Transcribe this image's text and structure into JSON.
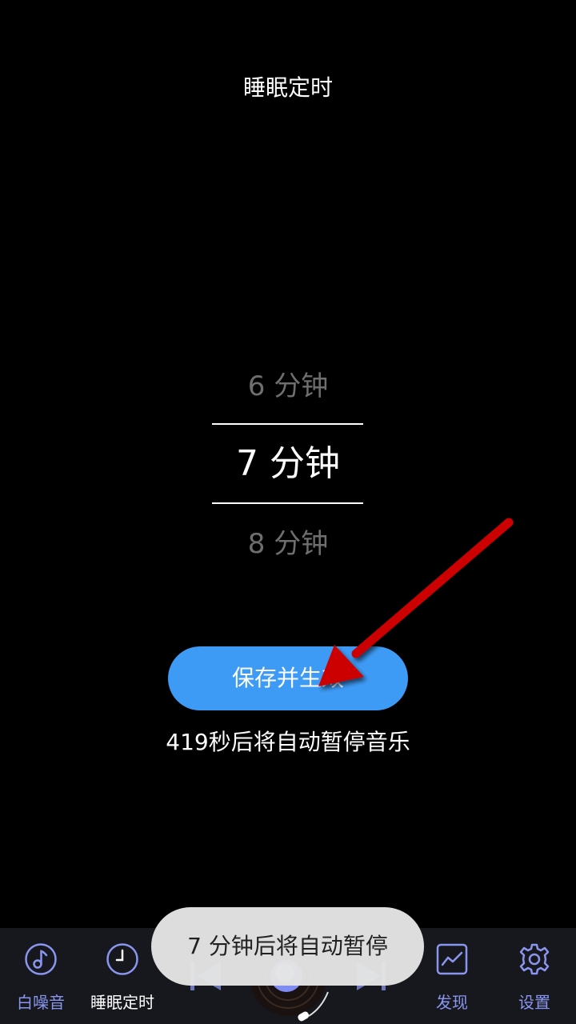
{
  "header": {
    "title": "睡眠定时"
  },
  "picker": {
    "previous": "6 分钟",
    "selected": "7 分钟",
    "next": "8 分钟"
  },
  "actions": {
    "save_label": "保存并生效"
  },
  "status": {
    "countdown_text": "419秒后将自动暂停音乐"
  },
  "toast": {
    "message": "7 分钟后将自动暂停"
  },
  "bottom_nav": {
    "items": [
      {
        "label": "白噪音",
        "icon": "music-note-icon"
      },
      {
        "label": "睡眠定时",
        "icon": "clock-icon"
      },
      {
        "label": "发现",
        "icon": "trend-chart-icon"
      },
      {
        "label": "设置",
        "icon": "gear-icon"
      }
    ]
  },
  "colors": {
    "background": "#000000",
    "button": "#3e9bf5",
    "nav_background": "#16181e",
    "nav_accent": "#8a96ee",
    "arrow": "#cc0000",
    "toast_background": "#e4e4e4"
  }
}
